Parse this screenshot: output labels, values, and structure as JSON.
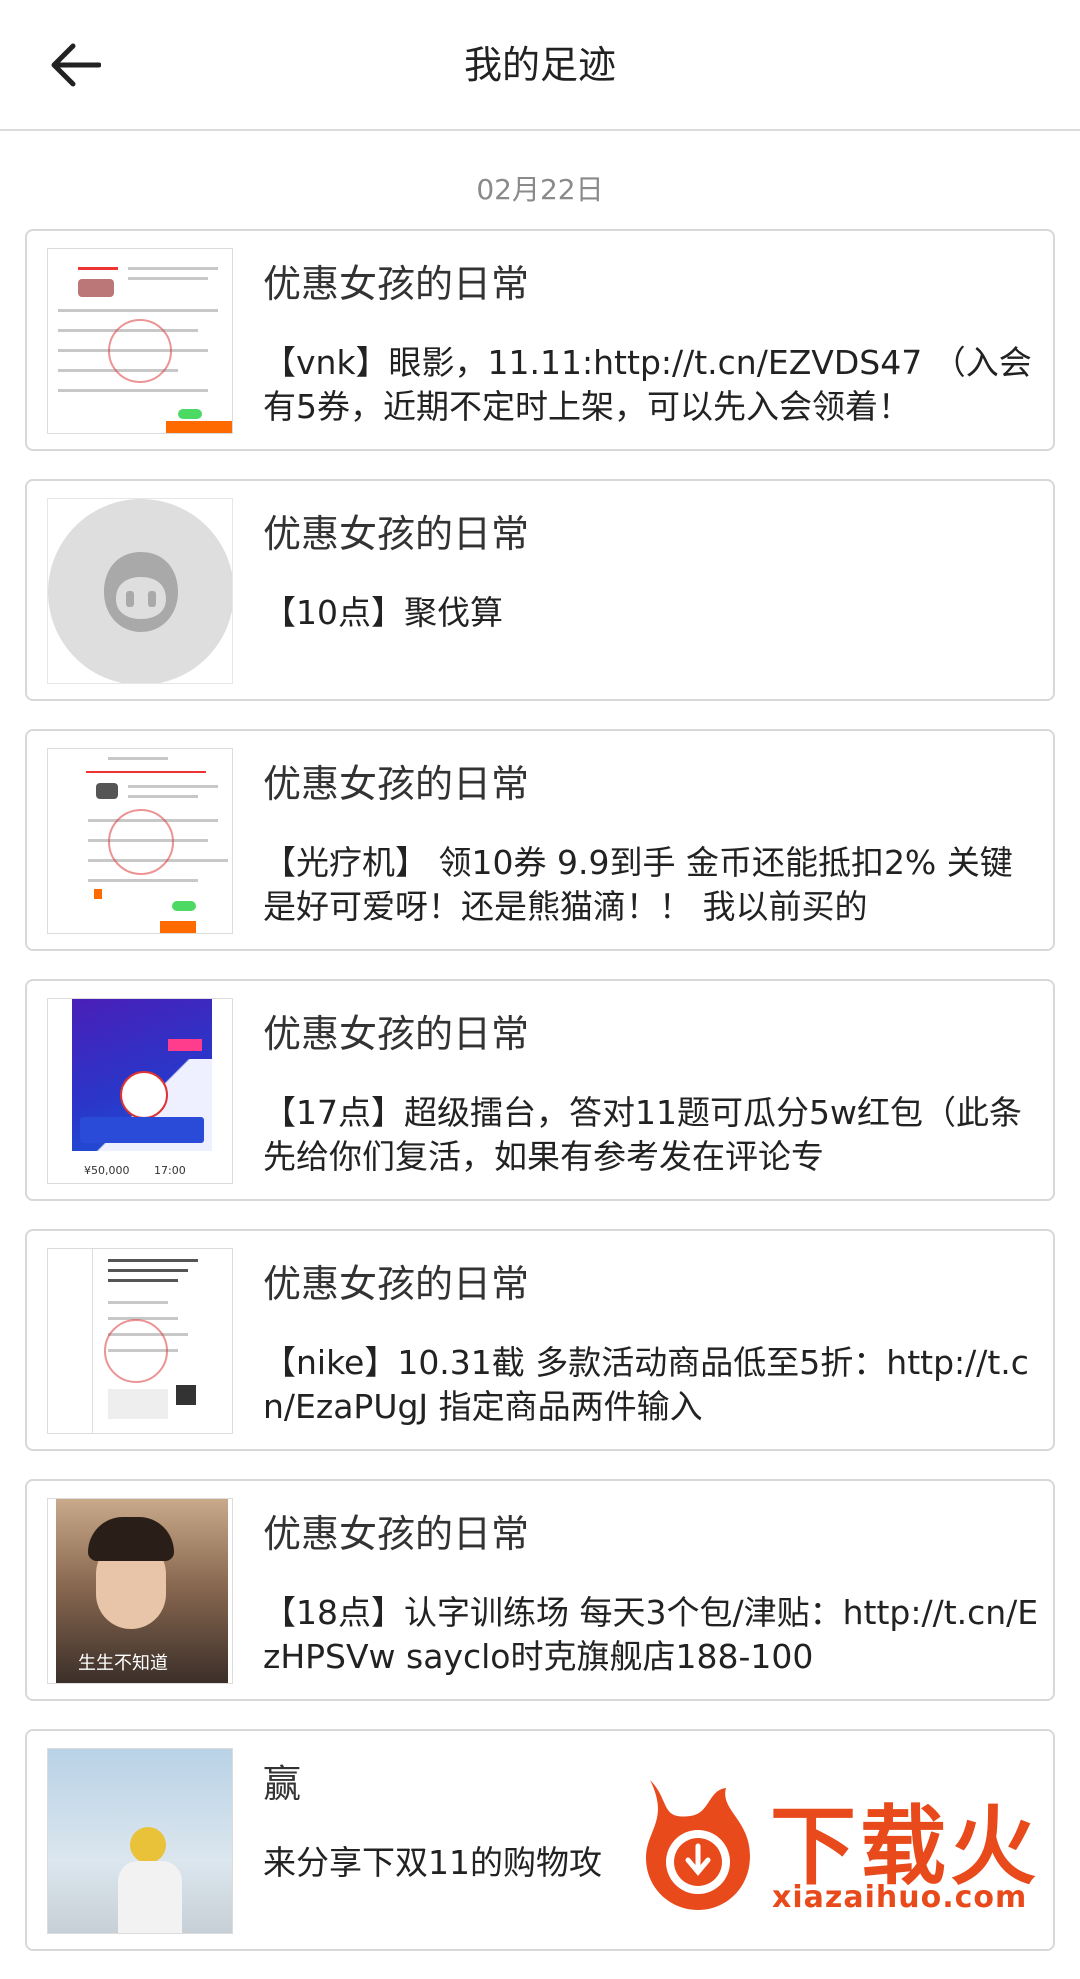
{
  "header": {
    "title": "我的足迹"
  },
  "date_label": "02月22日",
  "items": [
    {
      "author": "优惠女孩的日常",
      "text": "【vnk】眼影，11.11:http://t.cn/EZVDS47 （入会有5券，近期不定时上架，可以先入会领着！"
    },
    {
      "author": "优惠女孩的日常",
      "text": "【10点】聚伐算"
    },
    {
      "author": "优惠女孩的日常",
      "text": "【光疗机】 领10券 9.9到手 金币还能抵扣2% 关键是好可爱呀！还是熊猫滴！！ 我以前买的"
    },
    {
      "author": "优惠女孩的日常",
      "text": "【17点】超级擂台，答对11题可瓜分5w红包（此条先给你们复活，如果有参考发在评论专"
    },
    {
      "author": "优惠女孩的日常",
      "text": "【nike】10.31截 多款活动商品低至5折：http://t.cn/EzaPUgJ 指定商品两件输入"
    },
    {
      "author": "优惠女孩的日常",
      "text": "【18点】认字训练场 每天3个包/津贴：http://t.cn/EzHPSVw sayclo时克旗舰店188-100"
    },
    {
      "author": "赢",
      "text": "来分享下双11的购物攻"
    }
  ],
  "thumbs": {
    "quiz_amount": "¥50,000",
    "quiz_time": "17:00",
    "photo_caption": "生生不知道"
  },
  "watermark": {
    "brand": "下载火",
    "url": "xiazaihuo.com",
    "color": "#e84a1c"
  }
}
